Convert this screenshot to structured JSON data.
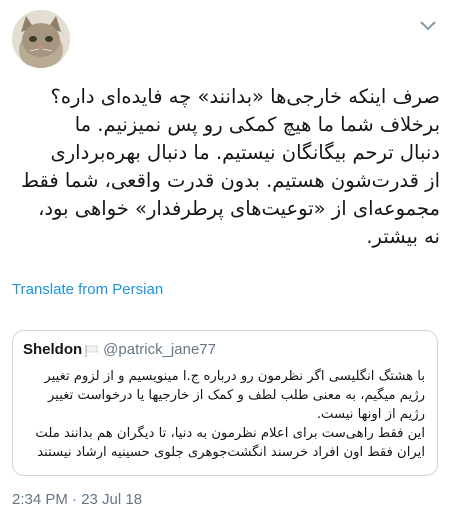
{
  "tweet": {
    "lines": [
      "صرف اینکه خارجی‌ها «بدانند» چه فایده‌ای داره؟",
      "برخلاف شما ما هیچ کمکی رو پس نمیزنیم. ما",
      "دنبال ترحم بیگانگان نیستیم. ما دنبال بهره‌برداری",
      "از قدرت‌شون هستیم. بدون قدرت واقعی، شما فقط",
      "مجموعه‌ای از «توعیت‌های پرطرفدار» خواهی بود،",
      "نه بیشتر."
    ],
    "translate_label": "Translate from Persian",
    "timestamp": "2:34 PM · 23 Jul 18"
  },
  "quoted_tweet": {
    "name": "Sheldon",
    "handle": "@patrick_jane77",
    "lines": [
      "با هشتگ انگلیسی اگر نظرمون رو درباره ج.ا مینویسیم و از لزوم تغییر",
      "رژیم میگیم، به معنی طلب لطف و کمک از خارجیها یا درخواست تغییر",
      "رژیم از اونها نیست.",
      "این فقط راهی‌ست برای اعلام نظرمون به دنیا، تا دیگران هم بدانند ملت",
      "ایران فقط اون افراد خرسند انگشت‌جوهری جلوی حسینیه ارشاد نیستند"
    ]
  },
  "icons": {
    "avatar": "cat-avatar",
    "menu": "chevron-down-icon",
    "flag": "white-flag-icon"
  },
  "colors": {
    "link": "#1b95e0",
    "secondary_text": "#657786",
    "border": "#ccd6dd"
  }
}
